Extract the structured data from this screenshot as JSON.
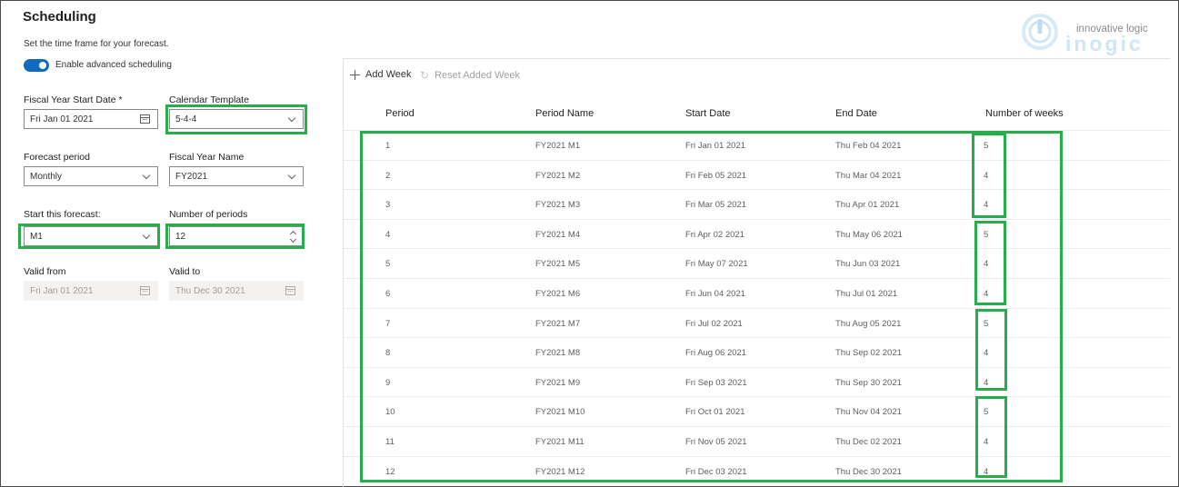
{
  "header": {
    "title": "Scheduling",
    "subtitle": "Set the time frame for your forecast."
  },
  "logo": {
    "tagline": "innovative logic",
    "wordmark": "inogic"
  },
  "toggle": {
    "label": "Enable advanced scheduling",
    "on": true
  },
  "form": {
    "fiscal_start_label": "Fiscal Year Start Date *",
    "fiscal_start_value": "Fri Jan 01 2021",
    "calendar_template_label": "Calendar Template",
    "calendar_template_value": "5-4-4",
    "forecast_period_label": "Forecast period",
    "forecast_period_value": "Monthly",
    "fiscal_year_name_label": "Fiscal Year Name",
    "fiscal_year_name_value": "FY2021",
    "start_forecast_label": "Start this forecast:",
    "start_forecast_value": "M1",
    "num_periods_label": "Number of periods",
    "num_periods_value": "12",
    "valid_from_label": "Valid from",
    "valid_from_value": "Fri Jan 01 2021",
    "valid_to_label": "Valid to",
    "valid_to_value": "Thu Dec 30 2021"
  },
  "toolbar": {
    "add_week": "Add Week",
    "reset_added_week": "Reset Added Week"
  },
  "table": {
    "columns": [
      "Period",
      "Period Name",
      "Start Date",
      "End Date",
      "Number of weeks"
    ],
    "rows": [
      [
        "1",
        "FY2021 M1",
        "Fri Jan 01 2021",
        "Thu Feb 04 2021",
        "5"
      ],
      [
        "2",
        "FY2021 M2",
        "Fri Feb 05 2021",
        "Thu Mar 04 2021",
        "4"
      ],
      [
        "3",
        "FY2021 M3",
        "Fri Mar 05 2021",
        "Thu Apr 01 2021",
        "4"
      ],
      [
        "4",
        "FY2021 M4",
        "Fri Apr 02 2021",
        "Thu May 06 2021",
        "5"
      ],
      [
        "5",
        "FY2021 M5",
        "Fri May 07 2021",
        "Thu Jun 03 2021",
        "4"
      ],
      [
        "6",
        "FY2021 M6",
        "Fri Jun 04 2021",
        "Thu Jul 01 2021",
        "4"
      ],
      [
        "7",
        "FY2021 M7",
        "Fri Jul 02 2021",
        "Thu Aug 05 2021",
        "5"
      ],
      [
        "8",
        "FY2021 M8",
        "Fri Aug 06 2021",
        "Thu Sep 02 2021",
        "4"
      ],
      [
        "9",
        "FY2021 M9",
        "Fri Sep 03 2021",
        "Thu Sep 30 2021",
        "4"
      ],
      [
        "10",
        "FY2021 M10",
        "Fri Oct 01 2021",
        "Thu Nov 04 2021",
        "5"
      ],
      [
        "11",
        "FY2021 M11",
        "Fri Nov 05 2021",
        "Thu Dec 02 2021",
        "4"
      ],
      [
        "12",
        "FY2021 M12",
        "Fri Dec 03 2021",
        "Thu Dec 30 2021",
        "4"
      ]
    ]
  },
  "colors": {
    "accent": "#0f6cbd",
    "highlight": "#27ae4a"
  }
}
